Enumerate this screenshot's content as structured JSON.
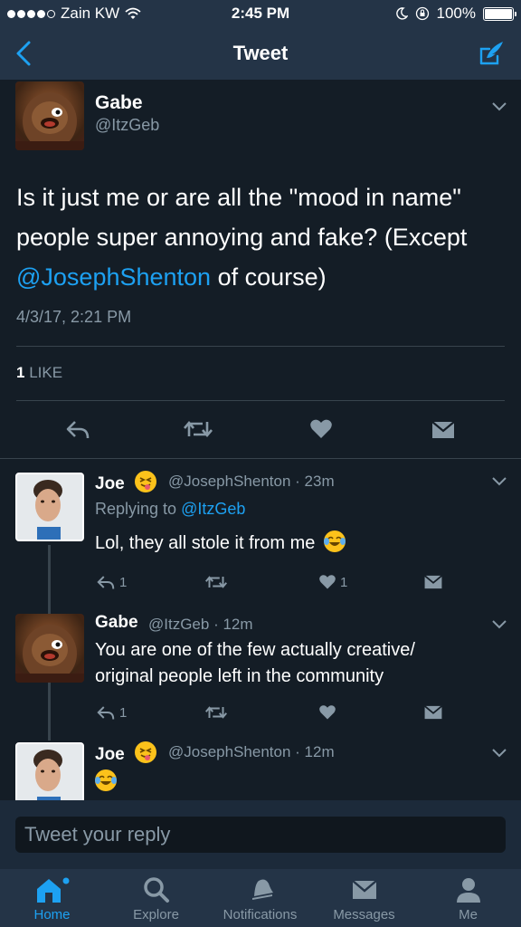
{
  "status_bar": {
    "carrier": "Zain KW",
    "time": "2:45 PM",
    "battery": "100%",
    "signal_bars_filled": 4,
    "signal_bars_total": 5
  },
  "nav": {
    "title": "Tweet"
  },
  "main_tweet": {
    "name": "Gabe",
    "handle": "@ItzGeb",
    "text_before": "Is it just me or are all the \"mood in name\" people super annoying and fake? (Except ",
    "mention": "@JosephShenton",
    "text_after": " of course)",
    "date": "4/3/17, 2:21 PM",
    "likes_count": "1",
    "likes_label": "LIKE"
  },
  "replies": [
    {
      "name": "Joe",
      "emoji": "squinting-face-with-tongue",
      "handle": "@JosephShenton",
      "time": "23m",
      "replying_label": "Replying to ",
      "replying_to": "@ItzGeb",
      "text": "Lol, they all stole it from me",
      "text_emoji": "face-with-tears-of-joy",
      "reply_count": "1",
      "like_count": "1"
    },
    {
      "name": "Gabe",
      "handle": "@ItzGeb",
      "time": "12m",
      "text_line1": "You are one of the few actually creative/",
      "text_line2": "original people left in the community",
      "reply_count": "1"
    },
    {
      "name": "Joe",
      "emoji": "squinting-face-with-tongue",
      "handle": "@JosephShenton",
      "time": "12m",
      "text_emoji": "face-with-tears-of-joy"
    }
  ],
  "reply_input": {
    "placeholder": "Tweet your reply"
  },
  "tabs": [
    {
      "label": "Home",
      "icon": "home-icon",
      "active": true
    },
    {
      "label": "Explore",
      "icon": "search-icon",
      "active": false
    },
    {
      "label": "Notifications",
      "icon": "bell-icon",
      "active": false
    },
    {
      "label": "Messages",
      "icon": "envelope-icon",
      "active": false
    },
    {
      "label": "Me",
      "icon": "person-icon",
      "active": false
    }
  ],
  "colors": {
    "background": "#141d26",
    "bar": "#243447",
    "accent": "#1da1f2",
    "secondary_text": "#8899a6",
    "divider": "#38444d"
  }
}
